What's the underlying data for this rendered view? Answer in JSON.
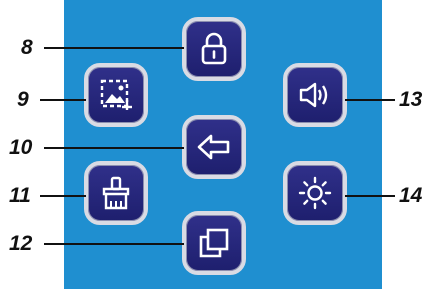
{
  "callouts": {
    "lock": "8",
    "screenshot": "9",
    "back": "10",
    "clean": "11",
    "recent_apps": "12",
    "volume": "13",
    "brightness": "14"
  },
  "colors": {
    "panel": "#1f8fd0",
    "button": "#26267a",
    "button_border": "#d9dbe4",
    "icon": "#ffffff"
  },
  "icons": {
    "lock": "lock-icon",
    "screenshot": "screenshot-icon",
    "back": "back-arrow-icon",
    "clean": "broom-icon",
    "recent_apps": "recent-apps-icon",
    "volume": "volume-icon",
    "brightness": "brightness-icon"
  }
}
